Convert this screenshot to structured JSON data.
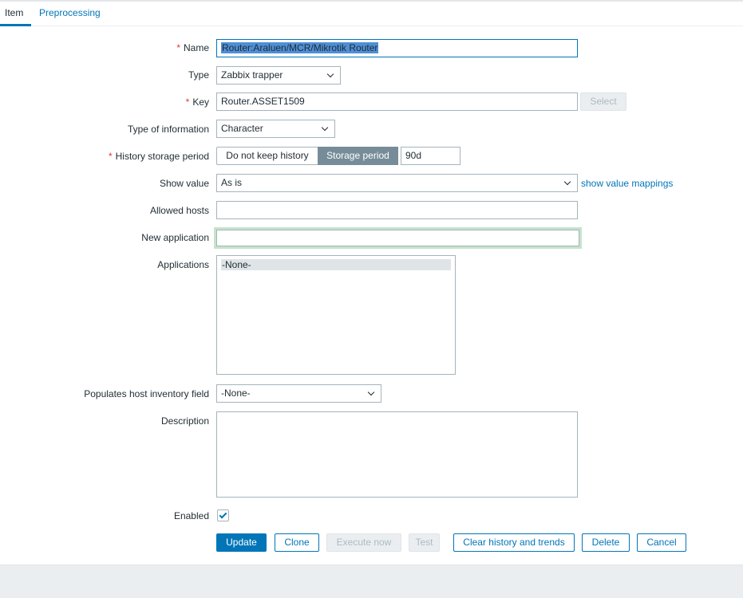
{
  "tabs": [
    {
      "label": "Item"
    },
    {
      "label": "Preprocessing"
    }
  ],
  "form": {
    "name": {
      "label": "Name",
      "value": "Router:Araluen/MCR/Mikrotik Router"
    },
    "type": {
      "label": "Type",
      "value": "Zabbix trapper"
    },
    "key": {
      "label": "Key",
      "value": "Router.ASSET1509",
      "select": "Select"
    },
    "type_of_information": {
      "label": "Type of information",
      "value": "Character"
    },
    "history": {
      "label": "History storage period",
      "option1": "Do not keep history",
      "option2": "Storage period",
      "value": "90d"
    },
    "show_value": {
      "label": "Show value",
      "value": "As is",
      "link": "show value mappings"
    },
    "allowed_hosts": {
      "label": "Allowed hosts",
      "value": ""
    },
    "new_application": {
      "label": "New application",
      "value": ""
    },
    "applications": {
      "label": "Applications",
      "options": [
        "-None-"
      ]
    },
    "inventory": {
      "label": "Populates host inventory field",
      "value": "-None-"
    },
    "description": {
      "label": "Description",
      "value": ""
    },
    "enabled": {
      "label": "Enabled",
      "checked": true
    }
  },
  "buttons": {
    "update": "Update",
    "clone": "Clone",
    "execute": "Execute now",
    "test": "Test",
    "clear": "Clear history and trends",
    "delete": "Delete",
    "cancel": "Cancel"
  }
}
